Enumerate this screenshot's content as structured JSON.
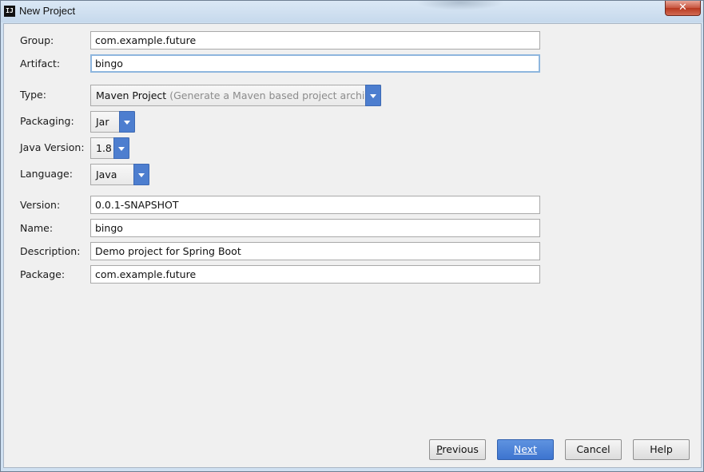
{
  "window": {
    "title": "New Project",
    "app_icon_text": "IJ",
    "close_label": "✕"
  },
  "form": {
    "group": {
      "label": "Group:",
      "value": "com.example.future"
    },
    "artifact": {
      "label": "Artifact:",
      "value": "bingo"
    },
    "type": {
      "label": "Type:",
      "value": "Maven Project",
      "hint": "(Generate a Maven based project archive)"
    },
    "packaging": {
      "label": "Packaging:",
      "value": "Jar"
    },
    "java_version": {
      "label": "Java Version:",
      "value": "1.8"
    },
    "language": {
      "label": "Language:",
      "value": "Java"
    },
    "version": {
      "label": "Version:",
      "value": "0.0.1-SNAPSHOT"
    },
    "name": {
      "label": "Name:",
      "value": "bingo"
    },
    "description": {
      "label": "Description:",
      "value": "Demo project for Spring Boot"
    },
    "package": {
      "label": "Package:",
      "value": "com.example.future"
    }
  },
  "buttons": {
    "previous": {
      "mnemonic": "P",
      "rest": "revious"
    },
    "next": {
      "mnemonic": "N",
      "rest": "ext"
    },
    "cancel": {
      "label": "Cancel"
    },
    "help": {
      "label": "Help"
    }
  },
  "colors": {
    "accent": "#4d7ecf",
    "focus_border": "#8eb6de",
    "dialog_bg": "#f0f0f0",
    "hint_text": "#8c8c8c"
  },
  "icons": {
    "app": "intellij-icon",
    "close": "close-icon",
    "dropdown": "chevron-down-icon"
  }
}
